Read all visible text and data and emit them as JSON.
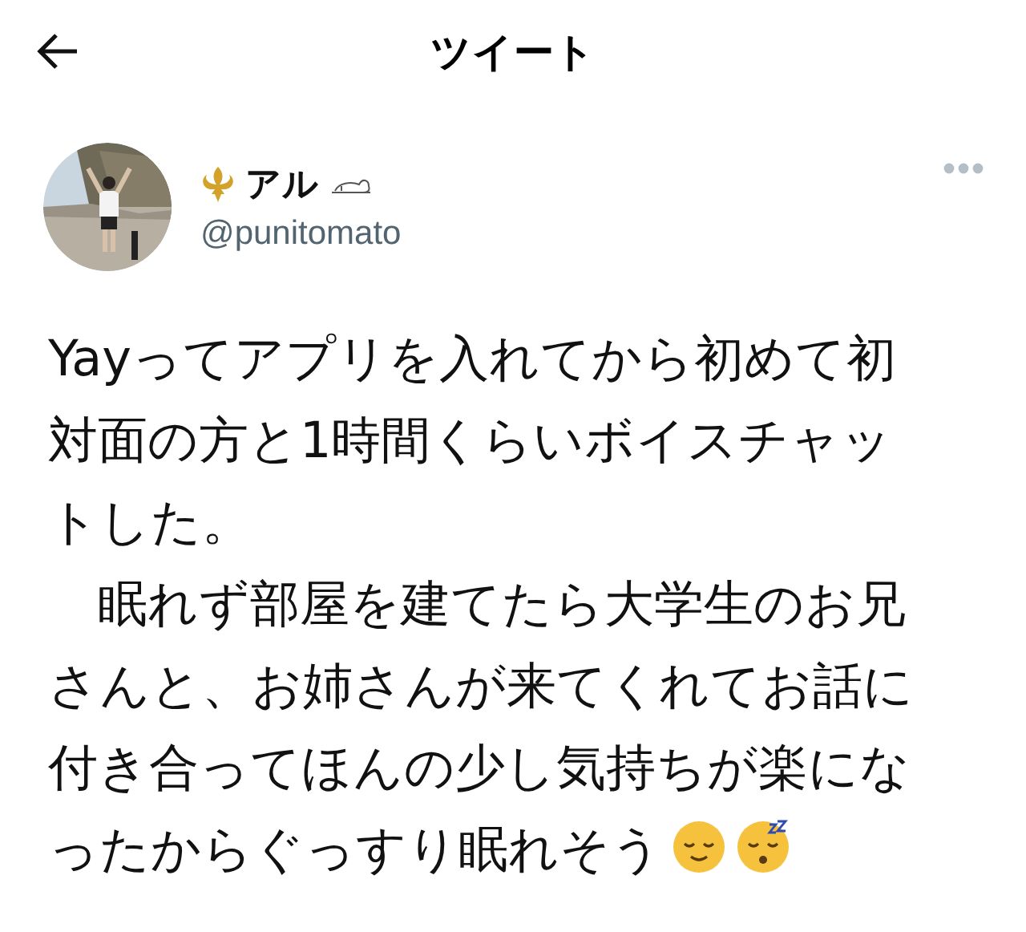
{
  "header": {
    "title": "ツイート"
  },
  "author": {
    "name": "アル",
    "handle": "@punitomato"
  },
  "paragraphs": [
    [
      "Yayってアプリを入れてから初めて初対面の方と1時間くらいボイスチャットした。"
    ],
    [
      "　眠れず部屋を建てたら大学生のお兄さんと、お姉さんが来てくれてお話に付き合ってほんの少し気持ちが楽にな",
      "ったからぐっすり眠れそう"
    ]
  ]
}
